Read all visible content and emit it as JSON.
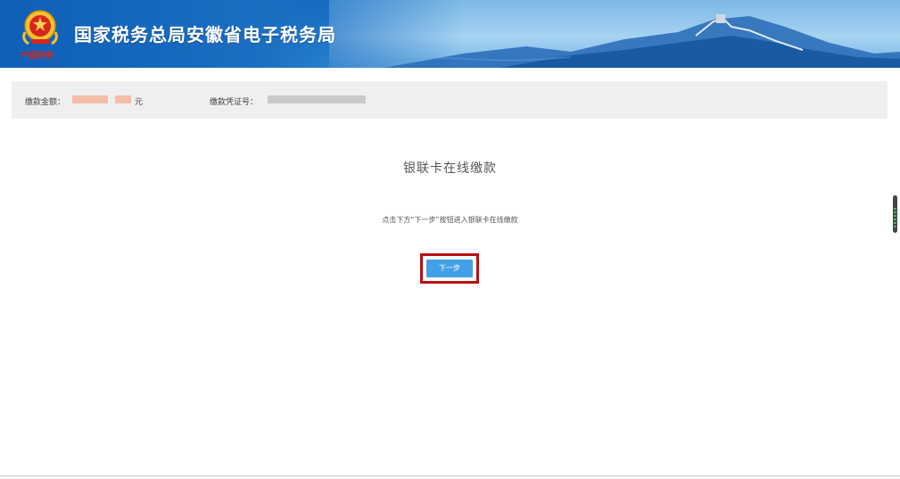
{
  "header": {
    "title": "国家税务总局安徽省电子税务局",
    "emblem_icon": "tax-emblem-icon",
    "emblem_caption": "中国税务"
  },
  "info_bar": {
    "amount_label": "缴款金额：",
    "amount_unit": "元",
    "voucher_label": "缴款凭证号："
  },
  "main": {
    "title": "银联卡在线缴款",
    "instruction": "点击下方“下一步”按钮进入银联卡在线缴款",
    "next_button_label": "下一步"
  },
  "colors": {
    "header_blue": "#1f7fd0",
    "button_blue": "#43a0e6",
    "highlight_red": "#b80f14",
    "info_bar_bg": "#efefef"
  }
}
